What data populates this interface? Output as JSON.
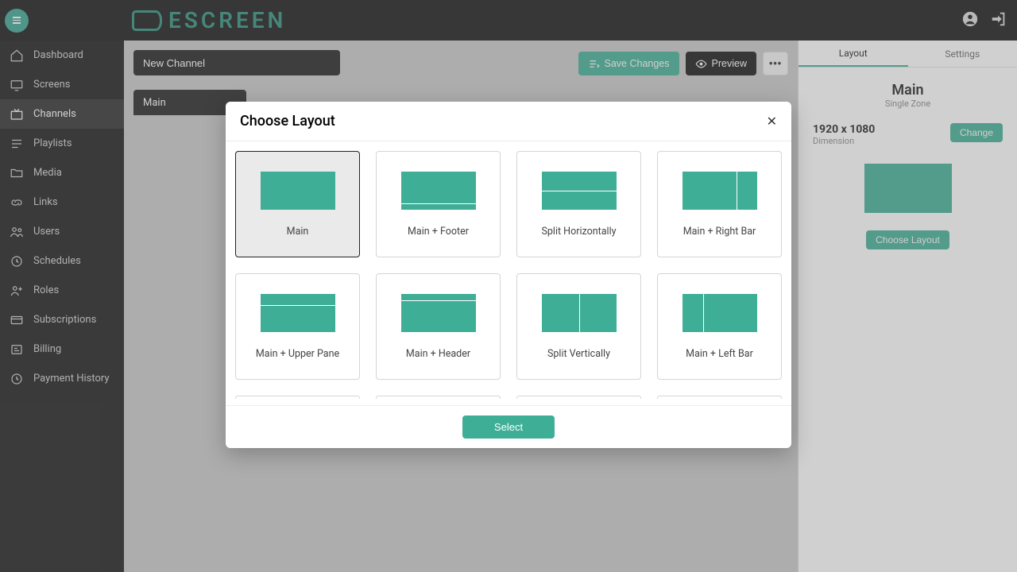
{
  "brand": "ESCREEN",
  "sidebar": {
    "items": [
      {
        "label": "Dashboard"
      },
      {
        "label": "Screens"
      },
      {
        "label": "Channels"
      },
      {
        "label": "Playlists"
      },
      {
        "label": "Media"
      },
      {
        "label": "Links"
      },
      {
        "label": "Users"
      },
      {
        "label": "Schedules"
      },
      {
        "label": "Roles"
      },
      {
        "label": "Subscriptions"
      },
      {
        "label": "Billing"
      },
      {
        "label": "Payment History"
      }
    ],
    "active_index": 2
  },
  "canvas": {
    "channel_name": "New Channel",
    "zone_tab": "Main"
  },
  "toolbar": {
    "save": "Save Changes",
    "preview": "Preview"
  },
  "rightpanel": {
    "tabs": {
      "layout": "Layout",
      "settings": "Settings"
    },
    "active_tab": "layout",
    "title": "Main",
    "subtitle": "Single Zone",
    "dimension_value": "1920 x 1080",
    "dimension_label": "Dimension",
    "change": "Change",
    "choose_layout": "Choose Layout"
  },
  "modal": {
    "title": "Choose Layout",
    "select": "Select",
    "selected_index": 0,
    "options": [
      {
        "label": "Main",
        "type": "main"
      },
      {
        "label": "Main + Footer",
        "type": "footer"
      },
      {
        "label": "Split Horizontally",
        "type": "split-h"
      },
      {
        "label": "Main + Right Bar",
        "type": "right-bar"
      },
      {
        "label": "Main + Upper Pane",
        "type": "upper-pane"
      },
      {
        "label": "Main + Header",
        "type": "header"
      },
      {
        "label": "Split Vertically",
        "type": "split-v"
      },
      {
        "label": "Main + Left Bar",
        "type": "left-bar"
      }
    ]
  }
}
